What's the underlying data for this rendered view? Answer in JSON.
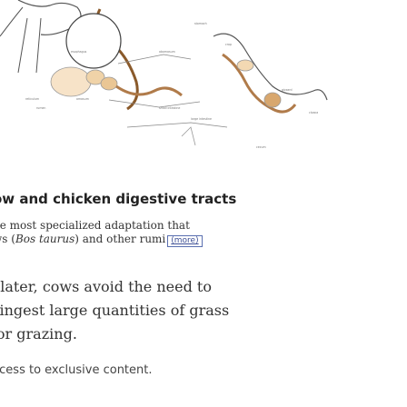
{
  "figure": {
    "labels": [
      "stomach",
      "esophagus",
      "rumen",
      "reticulum",
      "omasum",
      "abomasum",
      "small intestine",
      "large intestine",
      "cecum",
      "crop",
      "gizzard",
      "cloaca"
    ]
  },
  "caption": {
    "title": "ow and chicken digestive tracts",
    "line1": "he most specialized adaptation that",
    "line2_prefix": "ws (",
    "line2_italic": "Bos taurus",
    "line2_suffix": ") and other rumi",
    "more_label": "(more)"
  },
  "body": {
    "line1": "l later, cows avoid the need to",
    "line2": "' ingest large quantities of grass",
    "line3": "for grazing."
  },
  "access_text": "ccess to exclusive content."
}
